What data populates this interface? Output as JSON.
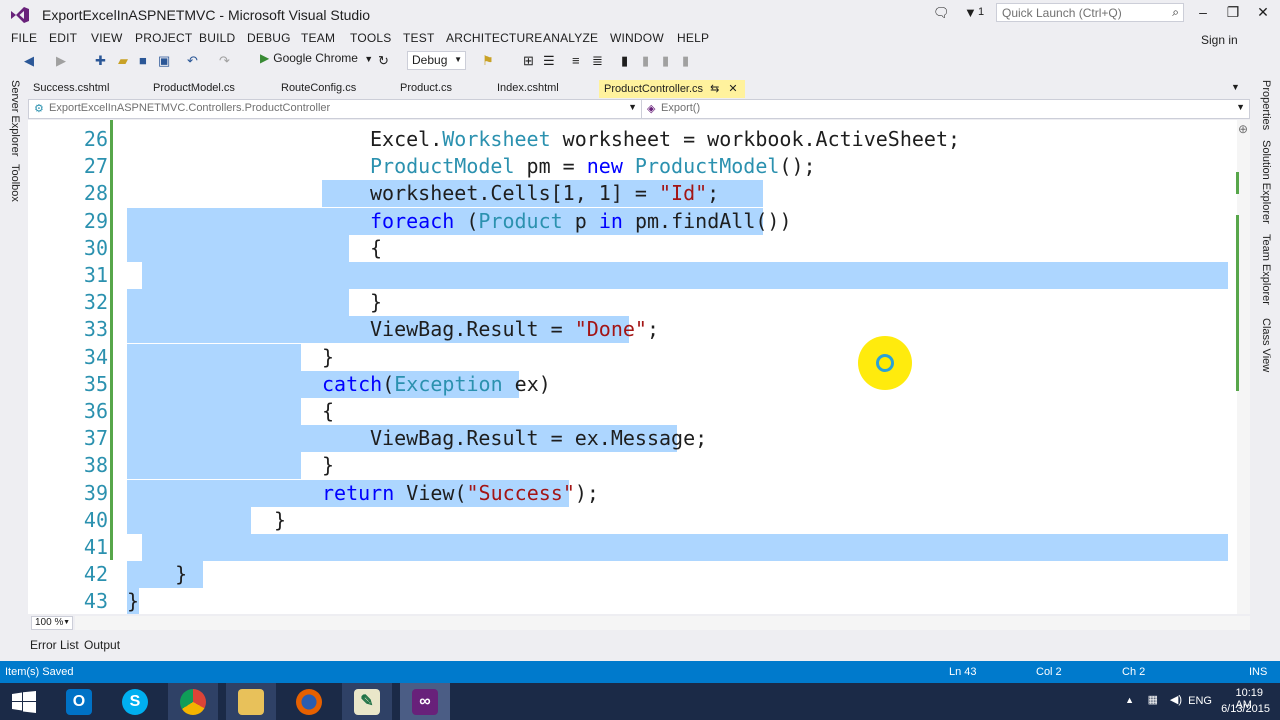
{
  "window": {
    "title": "ExportExcelInASPNETMVC - Microsoft Visual Studio",
    "notification_count": "1",
    "quick_launch_placeholder": "Quick Launch (Ctrl+Q)",
    "sign_in": "Sign in"
  },
  "menu": [
    "FILE",
    "EDIT",
    "VIEW",
    "PROJECT",
    "BUILD",
    "DEBUG",
    "TEAM",
    "TOOLS",
    "TEST",
    "ARCHITECTURE",
    "ANALYZE",
    "WINDOW",
    "HELP"
  ],
  "toolbar": {
    "run_label": "Google Chrome",
    "configuration": "Debug"
  },
  "left_rail": [
    "Server Explorer",
    "Toolbox"
  ],
  "right_rail": [
    "Properties",
    "Solution Explorer",
    "Team Explorer",
    "Class View"
  ],
  "doc_tabs": [
    "Success.cshtml",
    "ProductModel.cs",
    "RouteConfig.cs",
    "Product.cs",
    "Index.cshtml",
    "ProductController.cs"
  ],
  "active_tab": "ProductController.cs",
  "navbar": {
    "type": "ExportExcelInASPNETMVC.Controllers.ProductController",
    "member": "Export()"
  },
  "editor": {
    "zoom": "100 %",
    "lines": [
      {
        "n": "26",
        "indent": 3,
        "tokens": [
          [
            "pl",
            "Excel."
          ],
          [
            "ty",
            "Worksheet"
          ],
          [
            "pl",
            " worksheet = workbook.ActiveSheet;"
          ]
        ]
      },
      {
        "n": "27",
        "indent": 3,
        "tokens": [
          [
            "ty",
            "ProductModel"
          ],
          [
            "pl",
            " pm = "
          ],
          [
            "kw",
            "new"
          ],
          [
            "pl",
            " "
          ],
          [
            "ty",
            "ProductModel"
          ],
          [
            "pl",
            "();"
          ]
        ]
      },
      {
        "n": "28",
        "indent": 3,
        "tokens": [
          [
            "pl",
            "worksheet.Cells[1, 1] = "
          ],
          [
            "st",
            "\"Id\""
          ],
          [
            "pl",
            ";"
          ]
        ]
      },
      {
        "n": "29",
        "indent": 3,
        "tokens": [
          [
            "kw",
            "foreach"
          ],
          [
            "pl",
            " ("
          ],
          [
            "ty",
            "Product"
          ],
          [
            "pl",
            " p "
          ],
          [
            "kw",
            "in"
          ],
          [
            "pl",
            " pm.findAll())"
          ]
        ]
      },
      {
        "n": "30",
        "indent": 3,
        "tokens": [
          [
            "pl",
            "{"
          ]
        ]
      },
      {
        "n": "31",
        "indent": 0,
        "tokens": []
      },
      {
        "n": "32",
        "indent": 3,
        "tokens": [
          [
            "pl",
            "}"
          ]
        ]
      },
      {
        "n": "33",
        "indent": 3,
        "tokens": [
          [
            "pl",
            "ViewBag.Result = "
          ],
          [
            "st",
            "\"Done\""
          ],
          [
            "pl",
            ";"
          ]
        ]
      },
      {
        "n": "34",
        "indent": 2,
        "tokens": [
          [
            "pl",
            "}"
          ]
        ]
      },
      {
        "n": "35",
        "indent": 2,
        "tokens": [
          [
            "kw",
            "catch"
          ],
          [
            "pl",
            "("
          ],
          [
            "ty",
            "Exception"
          ],
          [
            "pl",
            " ex)"
          ]
        ]
      },
      {
        "n": "36",
        "indent": 2,
        "tokens": [
          [
            "pl",
            "{"
          ]
        ]
      },
      {
        "n": "37",
        "indent": 3,
        "tokens": [
          [
            "pl",
            "ViewBag.Result = ex.Message;"
          ]
        ]
      },
      {
        "n": "38",
        "indent": 2,
        "tokens": [
          [
            "pl",
            "}"
          ]
        ]
      },
      {
        "n": "39",
        "indent": 2,
        "tokens": [
          [
            "kw",
            "return"
          ],
          [
            "pl",
            " View("
          ],
          [
            "st",
            "\"Success\""
          ],
          [
            "pl",
            ");"
          ]
        ]
      },
      {
        "n": "40",
        "indent": 1,
        "tokens": [
          [
            "pl",
            "}"
          ]
        ]
      },
      {
        "n": "41",
        "indent": 0,
        "tokens": []
      },
      {
        "n": "42",
        "indent": 0,
        "tokens": [
          [
            "pl",
            "    }"
          ]
        ]
      },
      {
        "n": "43",
        "indent": 0,
        "tokens": [
          [
            "pl",
            "}"
          ]
        ]
      }
    ]
  },
  "bottom_tabs": [
    "Error List",
    "Output"
  ],
  "status": {
    "message": "Item(s) Saved",
    "line": "Ln 43",
    "col": "Col 2",
    "ch": "Ch 2",
    "mode": "INS"
  },
  "taskbar": {
    "apps": [
      "Start",
      "Outlook",
      "Skype",
      "Chrome",
      "File Explorer",
      "Firefox",
      "Excel",
      "Visual Studio"
    ],
    "language": "ENG",
    "time": "10:19 AM",
    "date": "6/13/2015"
  },
  "colors": {
    "accent": "#007acc",
    "selection": "#add6ff",
    "keyword": "#0000ff",
    "type": "#2b91af",
    "string": "#a31515",
    "active_tab": "#fff29d",
    "taskbar": "#1b2a47"
  }
}
